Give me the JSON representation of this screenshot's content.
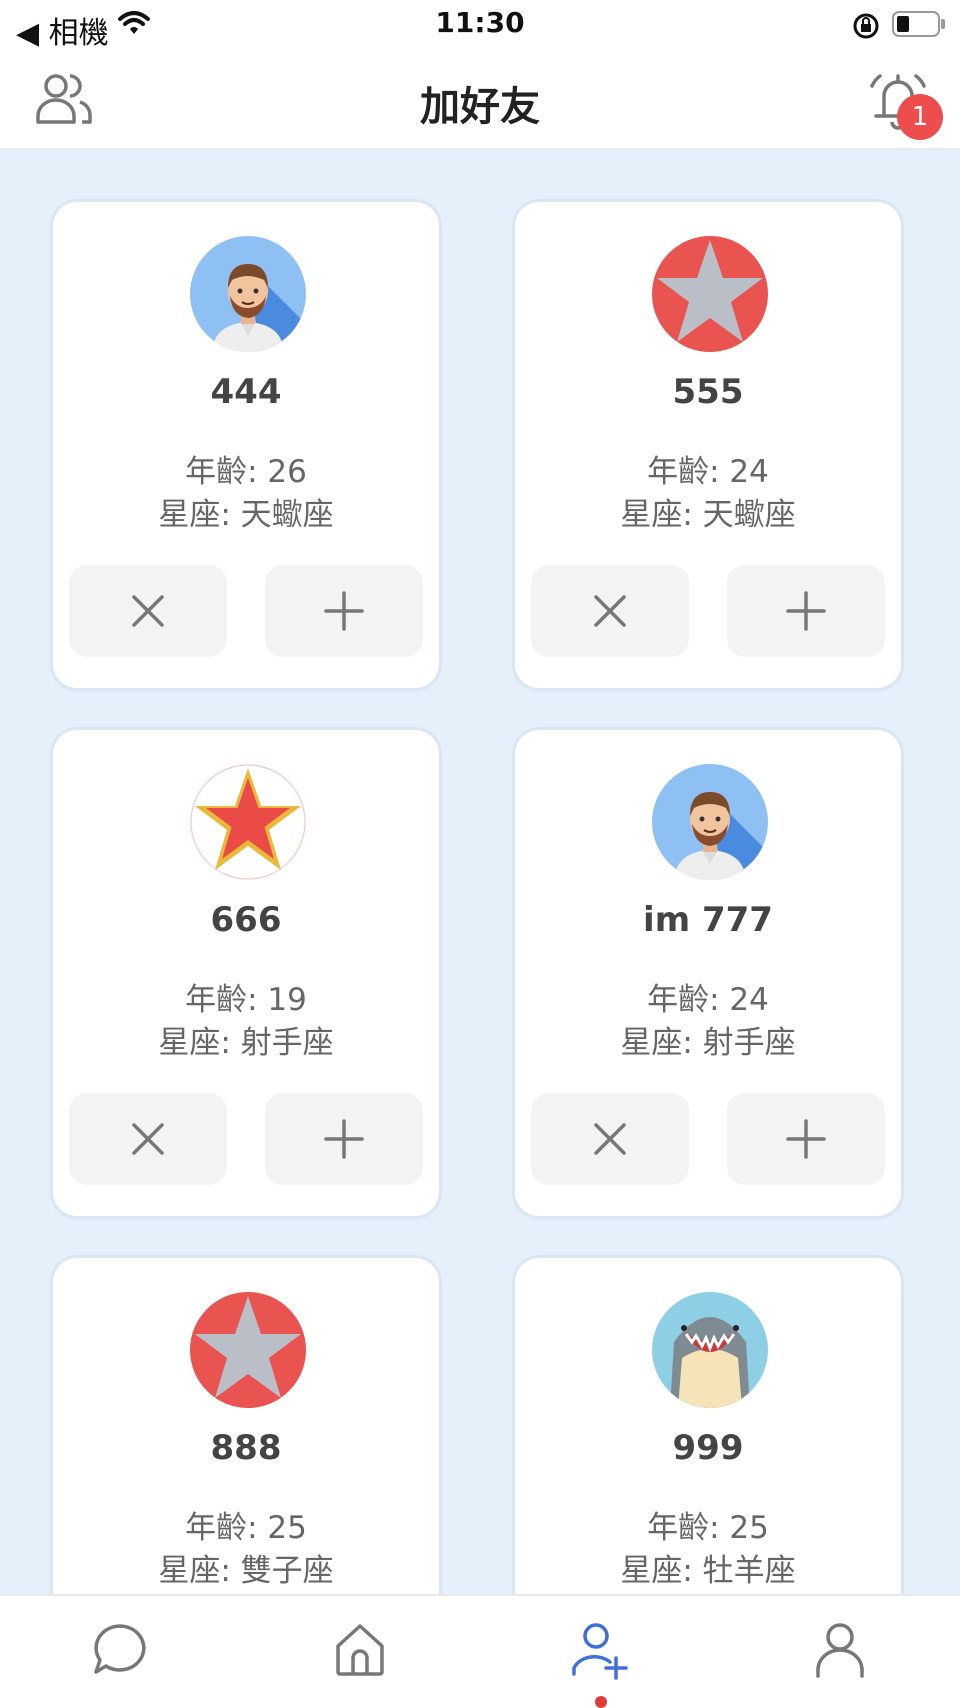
{
  "status_bar": {
    "back_app": "◀ 相機",
    "time": "11:30"
  },
  "header": {
    "title": "加好友",
    "notification_count": "1"
  },
  "cards": [
    {
      "name": "444",
      "age": "年齡: 26",
      "sign": "星座: 天蠍座",
      "avatar": "man-avatar"
    },
    {
      "name": "555",
      "age": "年齡: 24",
      "sign": "星座: 天蠍座",
      "avatar": "gray-star-avatar"
    },
    {
      "name": "666",
      "age": "年齡: 19",
      "sign": "星座: 射手座",
      "avatar": "red-star-avatar"
    },
    {
      "name": "im 777",
      "age": "年齡: 24",
      "sign": "星座: 射手座",
      "avatar": "man-avatar"
    },
    {
      "name": "888",
      "age": "年齡: 25",
      "sign": "星座: 雙子座",
      "avatar": "gray-star-avatar"
    },
    {
      "name": "999",
      "age": "年齡: 25",
      "sign": "星座: 牡羊座",
      "avatar": "shark-avatar"
    }
  ],
  "nav": [
    {
      "icon": "chat-icon"
    },
    {
      "icon": "home-icon"
    },
    {
      "icon": "add-friend-icon",
      "active": true
    },
    {
      "icon": "profile-icon"
    }
  ],
  "colors": {
    "accent": "#3f6fd8",
    "badge": "#ee4d4d",
    "background": "#e6f0fb"
  }
}
